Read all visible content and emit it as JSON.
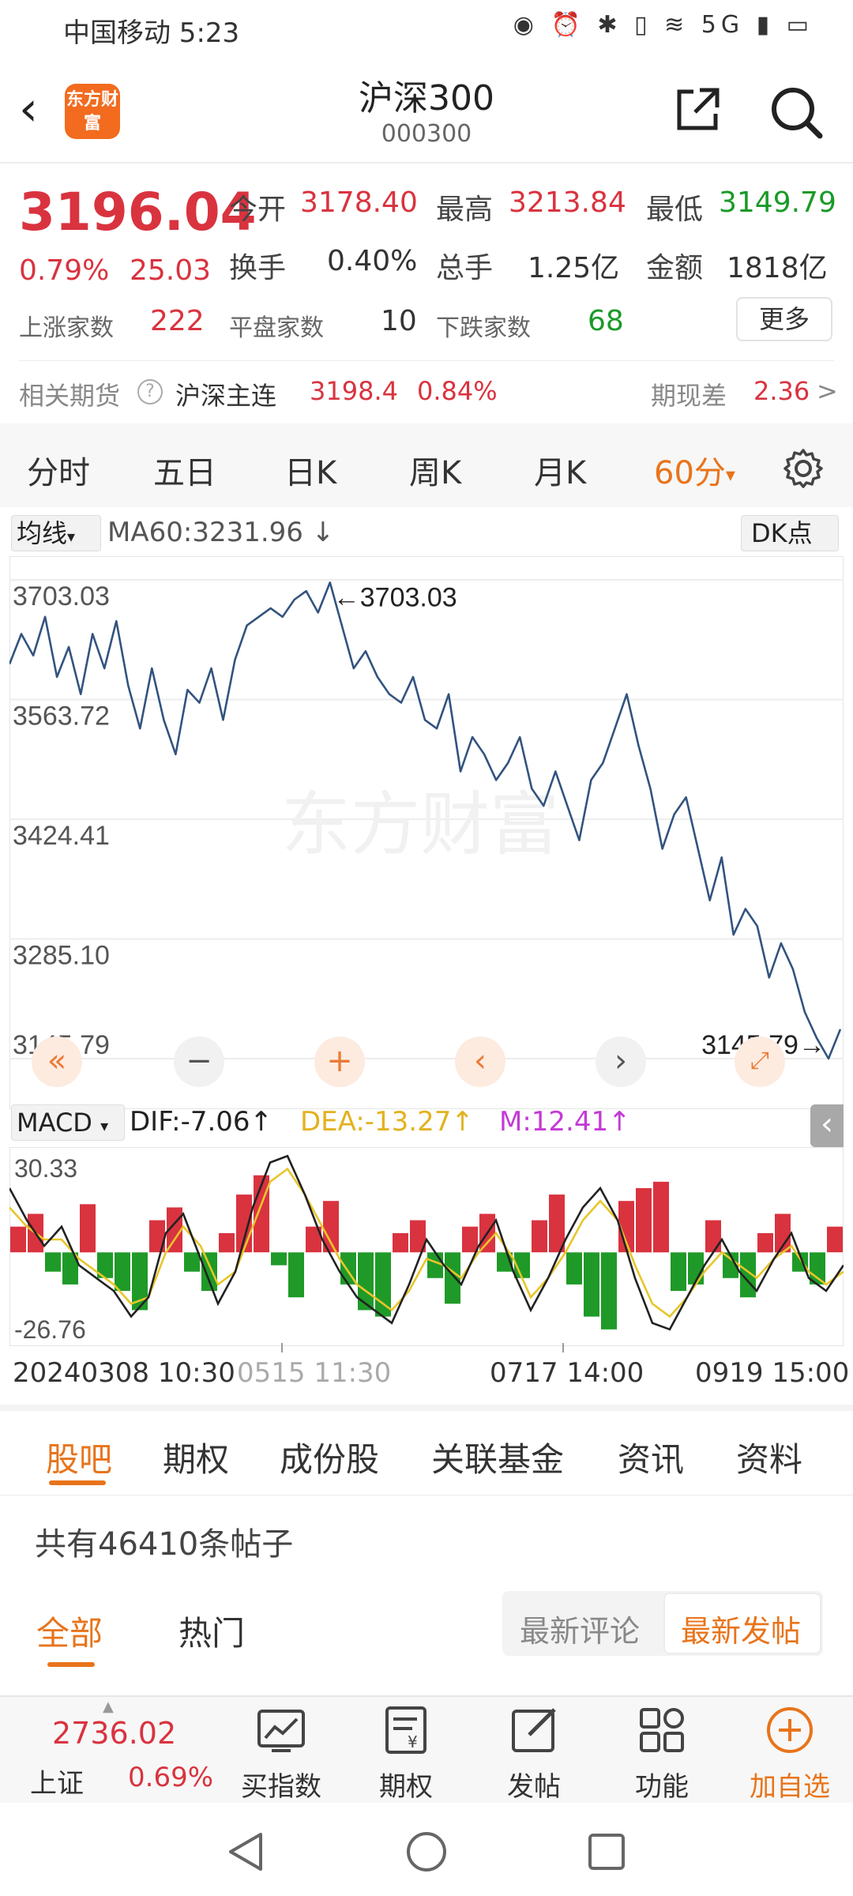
{
  "status_bar": {
    "carrier_time": "中国移动 5:23",
    "icons": "◉ ⏰ ✱ ▯ ≋ 5G ▮ ▭"
  },
  "header": {
    "logo_text": "东方财富",
    "title": "沪深300",
    "code": "000300"
  },
  "quote": {
    "price": "3196.04",
    "change_pct": "0.79%",
    "change": "25.03",
    "open_label": "今开",
    "open": "3178.40",
    "high_label": "最高",
    "high": "3213.84",
    "low_label": "最低",
    "low": "3149.79",
    "turnover_label": "换手",
    "turnover": "0.40%",
    "volume_label": "总手",
    "volume": "1.25亿",
    "amount_label": "金额",
    "amount": "1818亿",
    "up_label": "上涨家数",
    "up": "222",
    "flat_label": "平盘家数",
    "flat": "10",
    "down_label": "下跌家数",
    "down": "68",
    "more_label": "更多"
  },
  "futures": {
    "label": "相关期货",
    "help": "?",
    "name": "沪深主连",
    "price": "3198.4",
    "pct": "0.84%",
    "basis_label": "期现差",
    "basis": "2.36",
    "arrow": ">"
  },
  "period_tabs": [
    "分时",
    "五日",
    "日K",
    "周K",
    "月K",
    "60分"
  ],
  "period_active_caret": "▾",
  "chart_header": {
    "indicator": "均线",
    "caret": "▾",
    "ma": "MA60:3231.96 ↓",
    "dk": "DK点"
  },
  "chart_data": {
    "type": "line",
    "y_ticks": [
      "3703.03",
      "3563.72",
      "3424.41",
      "3285.10",
      "3145.79"
    ],
    "ylim": [
      3145.79,
      3703.03
    ],
    "max_annotation": "←3703.03",
    "min_annotation": "3145.79→",
    "watermark": "东方财富",
    "series": [
      {
        "values": [
          3605,
          3640,
          3615,
          3660,
          3590,
          3625,
          3570,
          3640,
          3600,
          3655,
          3580,
          3530,
          3600,
          3540,
          3500,
          3575,
          3560,
          3600,
          3540,
          3610,
          3650,
          3660,
          3670,
          3660,
          3680,
          3690,
          3665,
          3700,
          3650,
          3600,
          3620,
          3590,
          3570,
          3560,
          3590,
          3540,
          3530,
          3570,
          3480,
          3520,
          3500,
          3470,
          3490,
          3520,
          3460,
          3440,
          3480,
          3440,
          3400,
          3470,
          3490,
          3530,
          3570,
          3510,
          3460,
          3390,
          3430,
          3450,
          3390,
          3330,
          3380,
          3290,
          3320,
          3300,
          3240,
          3280,
          3250,
          3200,
          3170,
          3145.79,
          3180
        ]
      }
    ],
    "macd": {
      "ylim": [
        -26.76,
        30.33
      ],
      "y_ticks": [
        "30.33",
        "-26.76"
      ],
      "dif": "DIF:-7.06↑",
      "dea": "DEA:-13.27↑",
      "m": "M:12.41↑",
      "label": "MACD",
      "hist": [
        8,
        12,
        -6,
        -10,
        15,
        -8,
        -12,
        -18,
        10,
        14,
        -6,
        -12,
        6,
        18,
        24,
        -4,
        -14,
        8,
        16,
        -10,
        -18,
        -20,
        6,
        10,
        -8,
        -16,
        8,
        12,
        -6,
        -8,
        10,
        18,
        -10,
        -20,
        -24,
        16,
        20,
        22,
        -12,
        -10,
        10,
        -8,
        -14,
        6,
        12,
        -6,
        -10,
        8
      ],
      "dif_line": [
        20,
        10,
        2,
        8,
        -4,
        -8,
        -12,
        -20,
        -14,
        6,
        12,
        -2,
        -16,
        -6,
        14,
        28,
        30,
        18,
        4,
        -6,
        -14,
        -18,
        -22,
        -10,
        4,
        -4,
        -10,
        2,
        10,
        -6,
        -18,
        -8,
        4,
        14,
        20,
        10,
        -8,
        -22,
        -24,
        -14,
        -4,
        4,
        -6,
        -12,
        -2,
        6,
        -8,
        -12,
        -4
      ],
      "dea_line": [
        14,
        8,
        4,
        4,
        -2,
        -6,
        -10,
        -16,
        -14,
        0,
        8,
        2,
        -10,
        -6,
        8,
        22,
        26,
        18,
        8,
        -2,
        -10,
        -14,
        -18,
        -12,
        -2,
        -4,
        -8,
        0,
        6,
        -2,
        -14,
        -8,
        0,
        10,
        16,
        10,
        -4,
        -16,
        -20,
        -14,
        -6,
        0,
        -4,
        -8,
        -2,
        2,
        -6,
        -10,
        -6
      ]
    }
  },
  "date_labels": [
    "20240308 10:30",
    "0515 11:30",
    "0717 14:00",
    "0919 15:00"
  ],
  "bottom_tabs": [
    "股吧",
    "期权",
    "成份股",
    "关联基金",
    "资讯",
    "资料"
  ],
  "posts_count": "共有46410条帖子",
  "sub_tabs": [
    "全部",
    "热门"
  ],
  "sort": [
    "最新评论",
    "最新发帖"
  ],
  "bottom_bar": {
    "index_value": "2736.02",
    "index_name": "上证",
    "index_pct": "0.69%",
    "items": [
      "买指数",
      "期权",
      "发帖",
      "功能",
      "加自选"
    ]
  }
}
